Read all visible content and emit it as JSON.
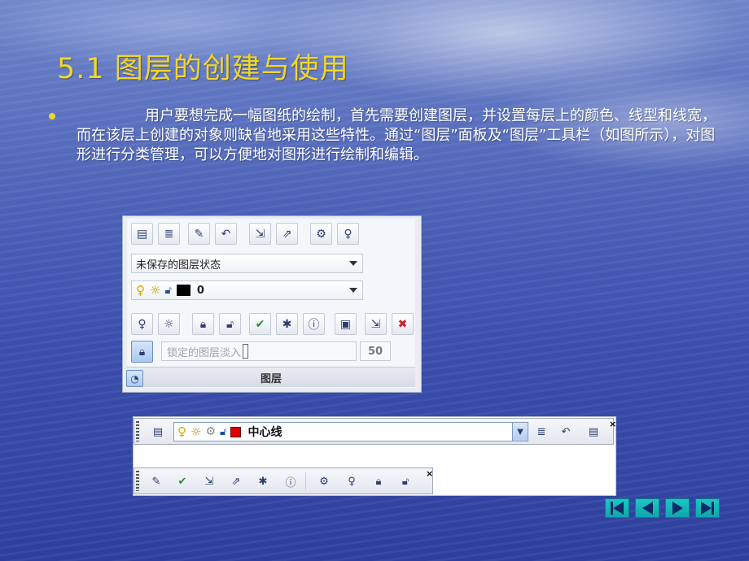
{
  "slide": {
    "title": "5.1  图层的创建与使用",
    "paragraph": "用户要想完成一幅图纸的绘制，首先需要创建图层，并设置每层上的颜色、线型和线宽，而在该层上创建的对象则缺省地采用这些特性。通过“图层”面板及“图层”工具栏（如图所示），对图形进行分类管理，可以方便地对图形进行绘制和编辑。"
  },
  "layer_panel": {
    "state_combo": "未保存的图层状态",
    "layer_combo_value": "0",
    "fade_label": "锁定的图层淡入",
    "fade_value": "50",
    "footer_label": "图层",
    "colors": {
      "layer0_swatch": "#000000"
    }
  },
  "layers_toolbar": {
    "layer_value": "中心线",
    "colors": {
      "swatch": "#e00000"
    },
    "close": "×"
  },
  "layers2_toolbar": {
    "close": "×"
  }
}
